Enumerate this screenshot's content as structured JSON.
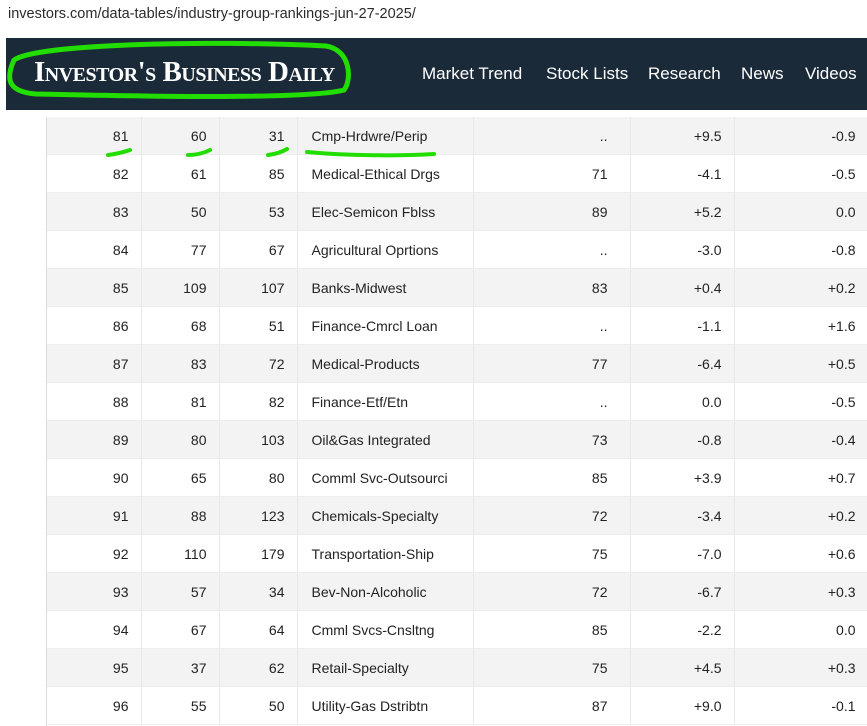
{
  "browser": {
    "url": "investors.com/data-tables/industry-group-rankings-jun-27-2025/"
  },
  "header": {
    "logo_text": "Investor's Business Daily",
    "nav": [
      "Market Trend",
      "Stock Lists",
      "Research",
      "News",
      "Videos"
    ]
  },
  "colors": {
    "header_bg": "#1b2a38",
    "highlight": "#22dd00",
    "row_alt": "#f3f3f3"
  },
  "table": {
    "rows": [
      [
        "81",
        "60",
        "31",
        "Cmp-Hrdwre/Perip",
        "..",
        "+9.5",
        "-0.9"
      ],
      [
        "82",
        "61",
        "85",
        "Medical-Ethical Drgs",
        "71",
        "-4.1",
        "-0.5"
      ],
      [
        "83",
        "50",
        "53",
        "Elec-Semicon Fblss",
        "89",
        "+5.2",
        "0.0"
      ],
      [
        "84",
        "77",
        "67",
        "Agricultural Oprtions",
        "..",
        "-3.0",
        "-0.8"
      ],
      [
        "85",
        "109",
        "107",
        "Banks-Midwest",
        "83",
        "+0.4",
        "+0.2"
      ],
      [
        "86",
        "68",
        "51",
        "Finance-Cmrcl Loan",
        "..",
        "-1.1",
        "+1.6"
      ],
      [
        "87",
        "83",
        "72",
        "Medical-Products",
        "77",
        "-6.4",
        "+0.5"
      ],
      [
        "88",
        "81",
        "82",
        "Finance-Etf/Etn",
        "..",
        "0.0",
        "-0.5"
      ],
      [
        "89",
        "80",
        "103",
        "Oil&Gas Integrated",
        "73",
        "-0.8",
        "-0.4"
      ],
      [
        "90",
        "65",
        "80",
        "Comml Svc-Outsourci",
        "85",
        "+3.9",
        "+0.7"
      ],
      [
        "91",
        "88",
        "123",
        "Chemicals-Specialty",
        "72",
        "-3.4",
        "+0.2"
      ],
      [
        "92",
        "110",
        "179",
        "Transportation-Ship",
        "75",
        "-7.0",
        "+0.6"
      ],
      [
        "93",
        "57",
        "34",
        "Bev-Non-Alcoholic",
        "72",
        "-6.7",
        "+0.3"
      ],
      [
        "94",
        "67",
        "64",
        "Cmml Svcs-Cnsltng",
        "85",
        "-2.2",
        "0.0"
      ],
      [
        "95",
        "37",
        "62",
        "Retail-Specialty",
        "75",
        "+4.5",
        "+0.3"
      ],
      [
        "96",
        "55",
        "50",
        "Utility-Gas Dstribtn",
        "87",
        "+9.0",
        "-0.1"
      ]
    ]
  }
}
